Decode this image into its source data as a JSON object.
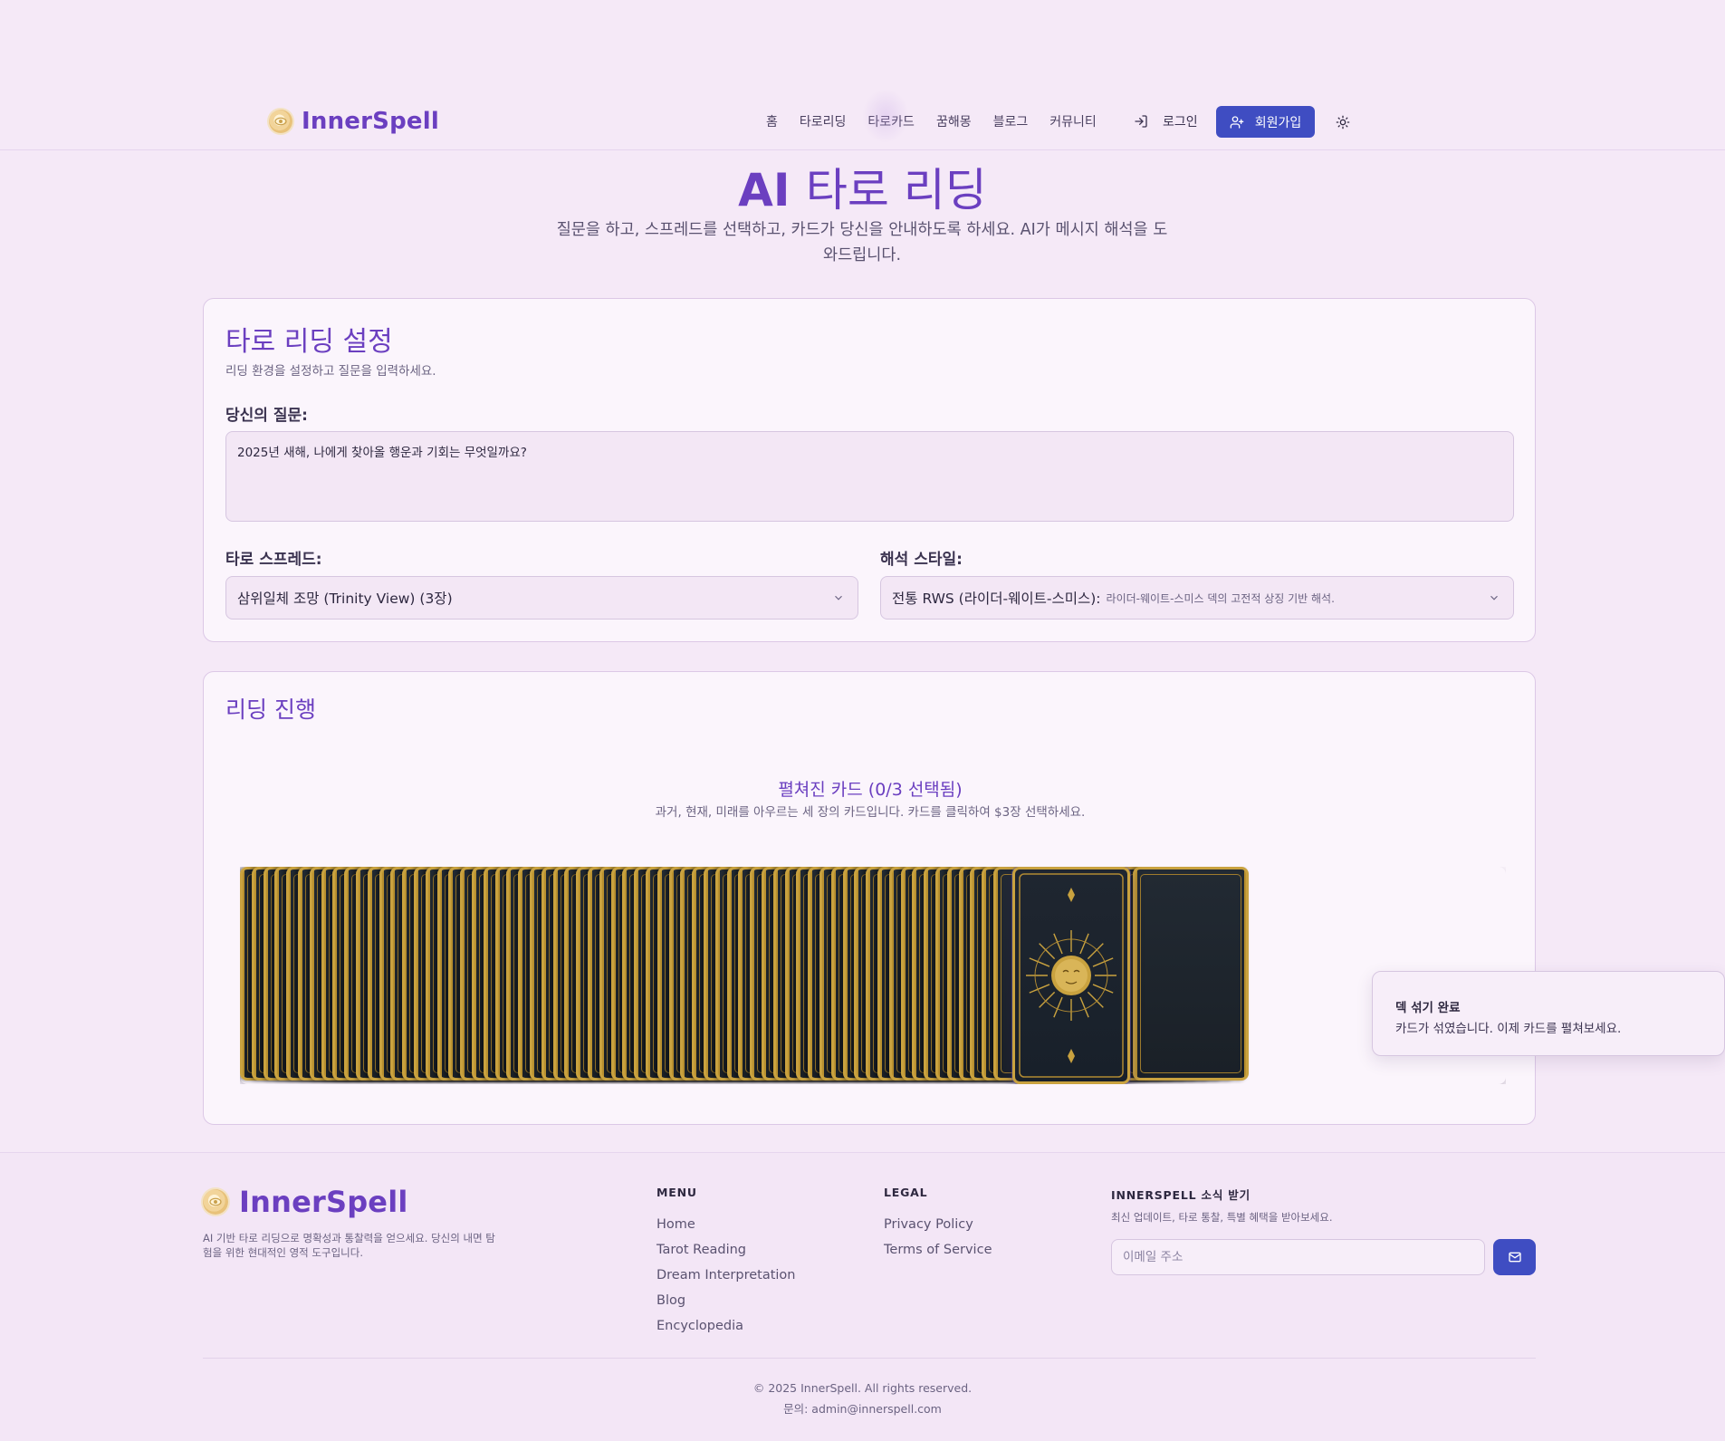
{
  "header": {
    "brand": "InnerSpell",
    "nav": [
      "홈",
      "타로리딩",
      "타로카드",
      "꿈해몽",
      "블로그",
      "커뮤니티"
    ],
    "active_nav": "타로카드",
    "login": "로그인",
    "signup": "회원가입"
  },
  "hero": {
    "title_ai": "AI",
    "title_rest": "타로 리딩",
    "subtitle": "질문을 하고, 스프레드를 선택하고, 카드가 당신을 안내하도록 하세요. AI가 메시지 해석을 도와드립니다."
  },
  "settings": {
    "title": "타로 리딩 설정",
    "description": "리딩 환경을 설정하고 질문을 입력하세요.",
    "question_label": "당신의 질문:",
    "question_value": "2025년 새해, 나에게 찾아올 행운과 기회는 무엇일까요?",
    "spread_label": "타로 스프레드:",
    "spread_value": "삼위일체 조망 (Trinity View) (3장)",
    "style_label": "해석 스타일:",
    "style_value": "전통 RWS (라이더-웨이트-스미스):",
    "style_desc": "라이더-웨이트-스미스 덱의 고전적 상징 기반 해석."
  },
  "reading": {
    "title": "리딩 진행",
    "spread_heading": "펼쳐진 카드 (0/3 선택됨)",
    "spread_sub": "과거, 현재, 미래를 아우르는 세 장의 카드입니다. 카드를 클릭하여 $3장 선택하세요.",
    "selected_count": 0,
    "total_to_select": 3
  },
  "toast": {
    "title": "덱 섞기 완료",
    "body": "카드가 섞였습니다. 이제 카드를 펼쳐보세요."
  },
  "footer": {
    "brand": "InnerSpell",
    "description": "AI 기반 타로 리딩으로 명확성과 통찰력을 얻으세요. 당신의 내면 탐험을 위한 현대적인 영적 도구입니다.",
    "menu_title": "MENU",
    "menu": [
      "Home",
      "Tarot Reading",
      "Dream Interpretation",
      "Blog",
      "Encyclopedia"
    ],
    "legal_title": "LEGAL",
    "legal": [
      "Privacy Policy",
      "Terms of Service"
    ],
    "newsletter_title": "INNERSPELL 소식 받기",
    "newsletter_desc": "최신 업데이트, 타로 통찰, 특별 혜택을 받아보세요.",
    "email_placeholder": "이메일 주소",
    "copyright": "© 2025 InnerSpell. All rights reserved.",
    "contact": "문의: admin@innerspell.com"
  },
  "colors": {
    "accent": "#6b3fc0",
    "primary_button": "#3f4dc2",
    "background": "#f5e9f7",
    "card_gold": "#c9a23f"
  },
  "icons": [
    "brand-logo-icon",
    "login-icon",
    "user-plus-icon",
    "sun-icon",
    "chevron-down-icon",
    "mail-icon",
    "sun-face-icon"
  ]
}
